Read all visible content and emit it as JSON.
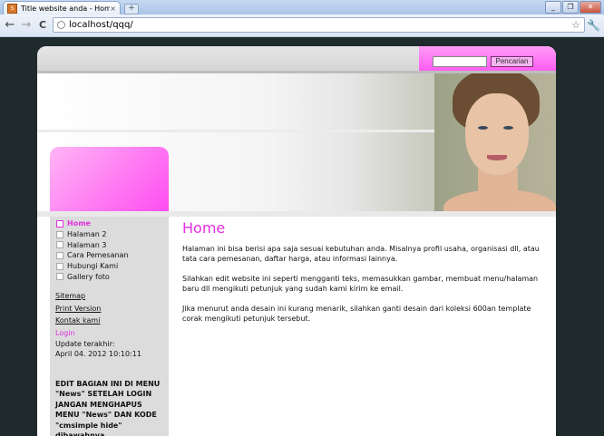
{
  "browser": {
    "tab_title": "Title website anda - Home",
    "tab_close": "×",
    "new_tab": "+",
    "favicon_text": "S",
    "url": "localhost/qqq/",
    "back": "←",
    "forward": "→",
    "reload": "C",
    "star": "☆",
    "wrench": "🔧",
    "minimize": "_",
    "restore": "❐",
    "close": "✕"
  },
  "search": {
    "value": "",
    "button_label": "Pencarian"
  },
  "sidebar": {
    "menu": [
      {
        "label": "Home",
        "active": true
      },
      {
        "label": "Halaman 2",
        "active": false
      },
      {
        "label": "Halaman 3",
        "active": false
      },
      {
        "label": "Cara Pemesanan",
        "active": false
      },
      {
        "label": "Hubungi Kami",
        "active": false
      },
      {
        "label": "Gallery foto",
        "active": false
      }
    ],
    "links": [
      "Sitemap",
      "Print Version",
      "Kontak kami"
    ],
    "login": "Login",
    "updated_label": "Update terakhir:",
    "updated_value": "April 04. 2012 10:10:11",
    "note": "EDIT BAGIAN INI DI MENU \"News\" SETELAH LOGIN JANGAN MENGHAPUS MENU \"News\" DAN KODE \"cmsimple hide\" dibawahnya"
  },
  "content": {
    "title": "Home",
    "paragraphs": [
      "Halaman ini bisa berisi apa saja sesuai kebutuhan anda. Misalnya profil usaha, organisasi dll, atau tata cara pemesanan, daftar harga, atau informasi lainnya.",
      "Silahkan edit website ini seperti mengganti teks, memasukkan gambar, membuat menu/halaman baru dll mengikuti petunjuk yang sudah kami kirim ke email.",
      "Jika menurut anda desain ini kurang menarik, silahkan ganti desain dari koleksi 600an template corak mengikuti petunjuk tersebut."
    ]
  },
  "colors": {
    "accent": "#e030e0",
    "pink_panel": "#ff5cf2",
    "page_bg": "#1f2a2d",
    "sidebar_bg": "#dcdcdc"
  }
}
